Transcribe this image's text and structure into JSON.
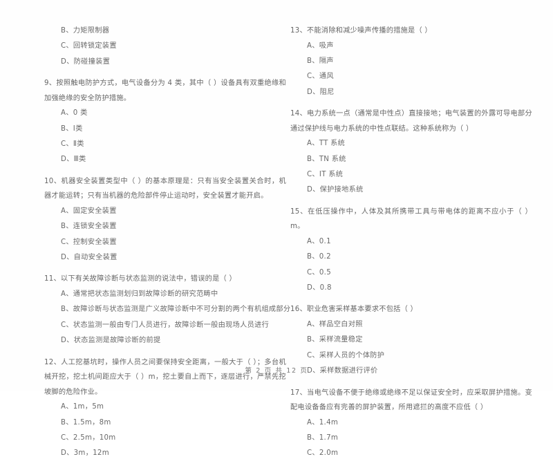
{
  "document": {
    "footer": "第 2 页 共 12 页",
    "page_number": 2,
    "total_pages": 12,
    "text_color": "#4a4a4a",
    "background_color": "#fefefe"
  },
  "left_column": {
    "orphan_options": [
      "B、力矩限制器",
      "C、回转锁定装置",
      "D、防碰撞装置"
    ],
    "questions": [
      {
        "number": "9",
        "stem": "9、按照触电防护方式，电气设备分为 4 类，其中（      ）设备具有双重绝缘和加强绝缘的安全防护措施。",
        "options": [
          "A、0 类",
          "B、Ⅰ类",
          "C、Ⅱ类",
          "D、Ⅲ类"
        ]
      },
      {
        "number": "10",
        "stem": "10、机器安全装置类型中（      ）的基本原理是：只有当安全装置关合时，机器才能运转；只有当机器的危险部件停止运动时，安全装置才能开启。",
        "options": [
          "A、固定安全装置",
          "B、连锁安全装置",
          "C、控制安全装置",
          "D、自动安全装置"
        ]
      },
      {
        "number": "11",
        "stem": "11、以下有关故障诊断与状态监测的说法中，错误的是（      ）",
        "options": [
          "A、通常把状态监测划归到故障诊断的研究范畴中",
          "B、故障诊断与状态监测是广义故障诊断中不可分割的两个有机组成部分",
          "C、状态监测一般由专门人员进行，故障诊断一般由现场人员进行",
          "D、状态监测是故障诊断的前提"
        ]
      },
      {
        "number": "12",
        "stem": "12、人工挖基坑时，操作人员之间要保持安全距离，一般大于（      ）；多台机械开挖，挖土机间距应大于（      ）m，挖土要自上而下，逐层进行，严禁先挖坡脚的危险作业。",
        "options": [
          "A、1m，5m",
          "B、1.5m，8m",
          "C、2.5m，10m",
          "D、3m，12m"
        ]
      }
    ]
  },
  "right_column": {
    "questions": [
      {
        "number": "13",
        "stem": "13、不能消除和减少噪声传播的措施是（      ）",
        "options": [
          "A、吸声",
          "B、隔声",
          "C、通风",
          "D、阻尼"
        ]
      },
      {
        "number": "14",
        "stem": "14、电力系统一点（通常是中性点）直接接地；电气装置的外露可导电部分通过保护线与电力系统的中性点联结。这种系统称为（      ）",
        "options": [
          "A、TT 系统",
          "B、TN 系统",
          "C、IT 系统",
          "D、保护接地系统"
        ]
      },
      {
        "number": "15",
        "stem": "15、在低压操作中，人体及其所携带工具与带电体的距离不应小于（      ）m。",
        "options": [
          "A、0.1",
          "B、0.2",
          "C、0.5",
          "D、0.8"
        ]
      },
      {
        "number": "16",
        "stem": "16、职业危害采样基本要求不包括（      ）",
        "options": [
          "A、样品空白对照",
          "B、采样流量稳定",
          "C、采样人员的个体防护",
          "D、采样数据进行评价"
        ]
      },
      {
        "number": "17",
        "stem": "17、当电气设备不便于绝缘或绝缘不足以保证安全时，应采取屏护措施。变配电设备备应有完善的屏护装置，所用遮拦的高度不应低（      ）",
        "options": [
          "A、1.4m",
          "B、1.7m",
          "C、2.0m"
        ]
      }
    ]
  }
}
